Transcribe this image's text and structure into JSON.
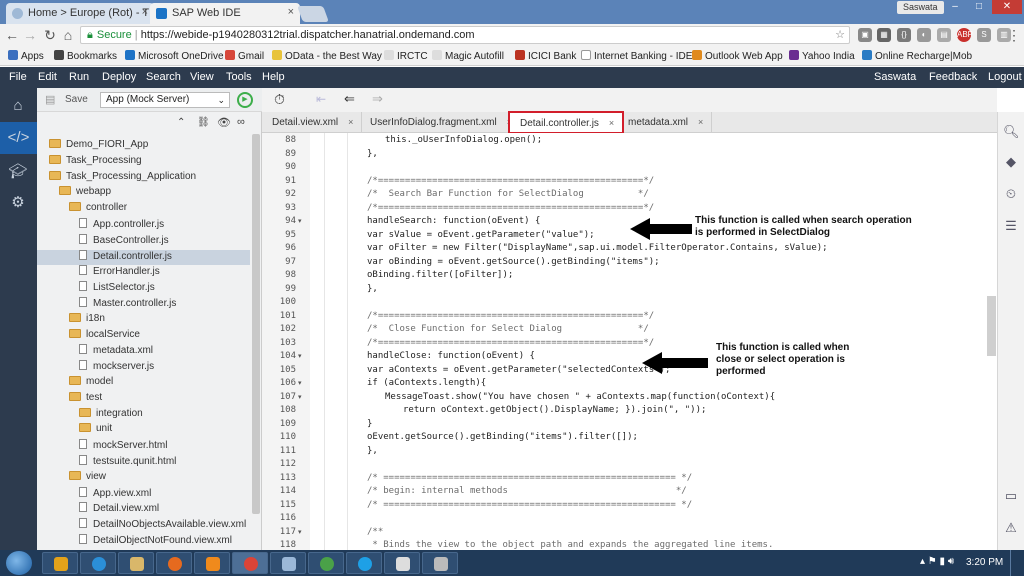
{
  "browser": {
    "tabs": [
      {
        "title": "Home > Europe (Rot) - T"
      },
      {
        "title": "SAP Web IDE"
      }
    ],
    "user_badge": "Saswata",
    "address": {
      "secure_label": "Secure",
      "url": "https://webide-p1940280312trial.dispatcher.hanatrial.ondemand.com"
    },
    "bookmarks": [
      "Apps",
      "Bookmarks",
      "Microsoft OneDrive",
      "Gmail",
      "OData - the Best Way",
      "IRCTC",
      "Magic Autofill",
      "ICICI Bank",
      "Internet Banking - IDE",
      "Outlook Web App",
      "Yahoo India",
      "Online Recharge|Mob"
    ]
  },
  "ide": {
    "menus": [
      "File",
      "Edit",
      "Run",
      "Deploy",
      "Search",
      "View",
      "Tools",
      "Help"
    ],
    "user": "Saswata",
    "feedback": "Feedback",
    "logout": "Logout",
    "save_label": "Save",
    "run_config": "App (Mock Server)",
    "tree": [
      {
        "label": "Demo_FIORI_App",
        "type": "folder",
        "depth": 0
      },
      {
        "label": "Task_Processing",
        "type": "folder",
        "depth": 0
      },
      {
        "label": "Task_Processing_Application",
        "type": "folder",
        "depth": 0
      },
      {
        "label": "webapp",
        "type": "folder",
        "depth": 1
      },
      {
        "label": "controller",
        "type": "folder",
        "depth": 2
      },
      {
        "label": "App.controller.js",
        "type": "file",
        "depth": 3
      },
      {
        "label": "BaseController.js",
        "type": "file",
        "depth": 3
      },
      {
        "label": "Detail.controller.js",
        "type": "file",
        "depth": 3,
        "selected": true
      },
      {
        "label": "ErrorHandler.js",
        "type": "file",
        "depth": 3
      },
      {
        "label": "ListSelector.js",
        "type": "file",
        "depth": 3
      },
      {
        "label": "Master.controller.js",
        "type": "file",
        "depth": 3
      },
      {
        "label": "i18n",
        "type": "folder",
        "depth": 2
      },
      {
        "label": "localService",
        "type": "folder",
        "depth": 2
      },
      {
        "label": "metadata.xml",
        "type": "file",
        "depth": 3
      },
      {
        "label": "mockserver.js",
        "type": "file",
        "depth": 3
      },
      {
        "label": "model",
        "type": "folder",
        "depth": 2
      },
      {
        "label": "test",
        "type": "folder",
        "depth": 2
      },
      {
        "label": "integration",
        "type": "folder",
        "depth": 3
      },
      {
        "label": "unit",
        "type": "folder",
        "depth": 3
      },
      {
        "label": "mockServer.html",
        "type": "file",
        "depth": 3
      },
      {
        "label": "testsuite.qunit.html",
        "type": "file",
        "depth": 3
      },
      {
        "label": "view",
        "type": "folder",
        "depth": 2
      },
      {
        "label": "App.view.xml",
        "type": "file",
        "depth": 3
      },
      {
        "label": "Detail.view.xml",
        "type": "file",
        "depth": 3
      },
      {
        "label": "DetailNoObjectsAvailable.view.xml",
        "type": "file",
        "depth": 3
      },
      {
        "label": "DetailObjectNotFound.view.xml",
        "type": "file",
        "depth": 3
      }
    ],
    "editor_tabs": [
      {
        "label": "Detail.view.xml"
      },
      {
        "label": "UserInfoDialog.fragment.xml"
      },
      {
        "label": "Detail.controller.js",
        "active": true
      },
      {
        "label": "metadata.xml"
      }
    ],
    "code_lines": [
      {
        "n": "88",
        "text": "this._oUserInfoDialog.open();",
        "indent": 1
      },
      {
        "n": "89",
        "text": "},",
        "indent": 0
      },
      {
        "n": "90",
        "text": "",
        "indent": 0
      },
      {
        "n": "91",
        "text": "/*=================================================*/",
        "indent": 0,
        "comment": true
      },
      {
        "n": "92",
        "text": "/*  Search Bar Function for SelectDialog          */",
        "indent": 0,
        "comment": true
      },
      {
        "n": "93",
        "text": "/*=================================================*/",
        "indent": 0,
        "comment": true
      },
      {
        "n": "94",
        "text": "handleSearch: function(oEvent) {",
        "indent": 0,
        "fold": true
      },
      {
        "n": "95",
        "text": "var sValue = oEvent.getParameter(\"value\");",
        "indent": 0
      },
      {
        "n": "96",
        "text": "var oFilter = new Filter(\"DisplayName\",sap.ui.model.FilterOperator.Contains, sValue);",
        "indent": 0
      },
      {
        "n": "97",
        "text": "var oBinding = oEvent.getSource().getBinding(\"items\");",
        "indent": 0
      },
      {
        "n": "98",
        "text": "oBinding.filter([oFilter]);",
        "indent": 0
      },
      {
        "n": "99",
        "text": "},",
        "indent": 0
      },
      {
        "n": "100",
        "text": "",
        "indent": 0
      },
      {
        "n": "101",
        "text": "/*=================================================*/",
        "indent": 0,
        "comment": true
      },
      {
        "n": "102",
        "text": "/*  Close Function for Select Dialog              */",
        "indent": 0,
        "comment": true
      },
      {
        "n": "103",
        "text": "/*=================================================*/",
        "indent": 0,
        "comment": true
      },
      {
        "n": "104",
        "text": "handleClose: function(oEvent) {",
        "indent": 0,
        "fold": true
      },
      {
        "n": "105",
        "text": "var aContexts = oEvent.getParameter(\"selectedContexts\");",
        "indent": 0
      },
      {
        "n": "106",
        "text": "if (aContexts.length){",
        "indent": 0,
        "fold": true
      },
      {
        "n": "107",
        "text": "MessageToast.show(\"You have chosen \" + aContexts.map(function(oContext){",
        "indent": 1,
        "fold": true
      },
      {
        "n": "108",
        "text": "return oContext.getObject().DisplayName; }).join(\", \"));",
        "indent": 2
      },
      {
        "n": "109",
        "text": "}",
        "indent": 0
      },
      {
        "n": "110",
        "text": "oEvent.getSource().getBinding(\"items\").filter([]);",
        "indent": 0
      },
      {
        "n": "111",
        "text": "},",
        "indent": 0
      },
      {
        "n": "112",
        "text": "",
        "indent": 0
      },
      {
        "n": "113",
        "text": "/* ====================================================== */",
        "indent": 0,
        "comment": true
      },
      {
        "n": "114",
        "text": "/* begin: internal methods                               */",
        "indent": 0,
        "comment": true
      },
      {
        "n": "115",
        "text": "/* ====================================================== */",
        "indent": 0,
        "comment": true
      },
      {
        "n": "116",
        "text": "",
        "indent": 0
      },
      {
        "n": "117",
        "text": "/**",
        "indent": 0,
        "comment": true,
        "fold": true
      },
      {
        "n": "118",
        "text": " * Binds the view to the object path and expands the aggregated line items.",
        "indent": 0,
        "comment": true
      }
    ],
    "annotations": [
      {
        "line1": "This function is called when search operation",
        "line2": "is performed in SelectDialog"
      },
      {
        "line1": "This function is called when",
        "line2": "close or select operation is",
        "line3": "performed"
      }
    ]
  },
  "taskbar": {
    "clock": "3:20 PM"
  }
}
